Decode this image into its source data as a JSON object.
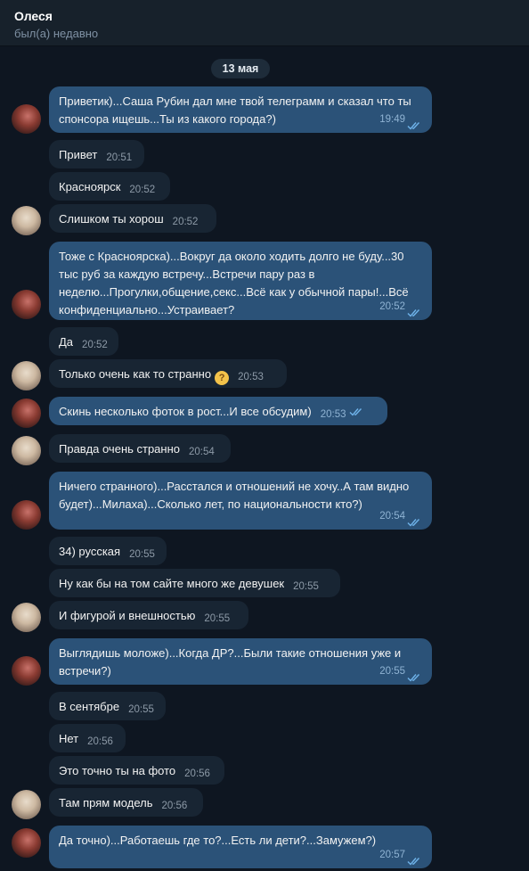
{
  "header": {
    "name": "Олеся",
    "status": "был(а) недавно"
  },
  "date_label": "13 мая",
  "colors": {
    "background": "#0e1621",
    "incoming_bubble": "#182533",
    "outgoing_bubble": "#2b5278",
    "read_check": "#5fa8e0"
  },
  "messages": [
    {
      "dir": "out",
      "lines": [
        "Приветик)...Саша Рубин дал мне твой телеграмм и сказал что ты",
        "спонсора ищешь...Ты из какого города?)"
      ],
      "time": "19:49",
      "read": true
    },
    {
      "dir": "in",
      "text": "Привет",
      "time": "20:51"
    },
    {
      "dir": "in",
      "text": "Красноярск",
      "time": "20:52"
    },
    {
      "dir": "in",
      "text": "Слишком ты хорош",
      "time": "20:52"
    },
    {
      "dir": "out",
      "lines": [
        "Тоже с Красноярска)...Вокруг да около ходить долго не буду...30",
        "тыс руб за каждую встречу...Встречи пару раз в",
        "неделю...Прогулки,общение,секс...Всё как у обычной пары!...Всё",
        "конфиденциально...Устраивает?"
      ],
      "time": "20:52",
      "read": true
    },
    {
      "dir": "in",
      "text": "Да",
      "time": "20:52"
    },
    {
      "dir": "in",
      "text": "Только очень как то странно",
      "time": "20:53",
      "emoji": "thinking-face"
    },
    {
      "dir": "out",
      "text": "Скинь несколько фоток в рост...И все обсудим)",
      "time": "20:53",
      "read": true
    },
    {
      "dir": "in",
      "text": "Правда очень странно",
      "time": "20:54"
    },
    {
      "dir": "out",
      "lines": [
        "Ничего странного)...Расстался и отношений не хочу..А там видно",
        "будет)...Милаха)...Сколько лет, по национальности кто?)"
      ],
      "time": "20:54",
      "read": true
    },
    {
      "dir": "in",
      "text": "34) русская",
      "time": "20:55"
    },
    {
      "dir": "in",
      "text": "Ну как бы на том сайте много же девушек",
      "time": "20:55"
    },
    {
      "dir": "in",
      "text": "И фигурой и внешностью",
      "time": "20:55"
    },
    {
      "dir": "out",
      "lines": [
        "Выглядишь моложе)...Когда ДР?...Были такие отношения уже и",
        "встречи?)"
      ],
      "time": "20:55",
      "read": true
    },
    {
      "dir": "in",
      "text": "В сентябре",
      "time": "20:55"
    },
    {
      "dir": "in",
      "text": "Нет",
      "time": "20:56"
    },
    {
      "dir": "in",
      "text": "Это точно ты на фото",
      "time": "20:56"
    },
    {
      "dir": "in",
      "text": "Там прям модель",
      "time": "20:56"
    },
    {
      "dir": "out",
      "lines": [
        "Да точно)...Работаешь где то?...Есть ли дети?...Замужем?)"
      ],
      "time": "20:57",
      "read": true
    }
  ]
}
